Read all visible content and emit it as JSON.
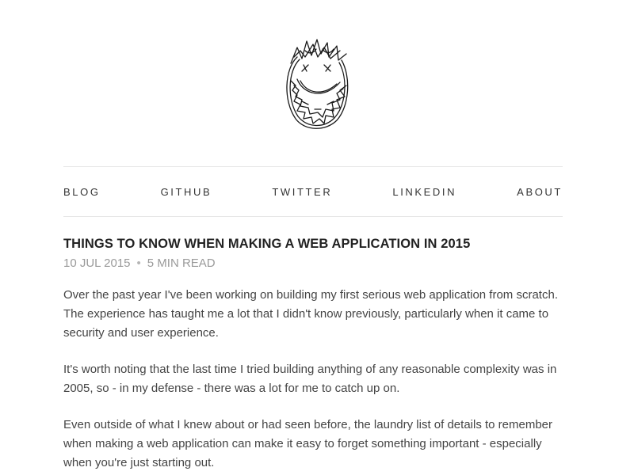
{
  "nav": {
    "items": [
      {
        "label": "BLOG"
      },
      {
        "label": "GITHUB"
      },
      {
        "label": "TWITTER"
      },
      {
        "label": "LINKEDIN"
      },
      {
        "label": "ABOUT"
      }
    ]
  },
  "logo": {
    "icon": "sketched-smiling-face-icon"
  },
  "post": {
    "title": "THINGS TO KNOW WHEN MAKING A WEB APPLICATION IN 2015",
    "date": "10 JUL 2015",
    "separator": "•",
    "read_time": "5 MIN READ",
    "paragraphs": [
      "Over the past year I've been working on building my first serious web application from scratch. The experience has taught me a lot that I didn't know previously, particularly when it came to security and user experience.",
      "It's worth noting that the last time I tried building anything of any reasonable complexity was in 2005, so - in my defense - there was a lot for me to catch up on.",
      "Even outside of what I knew about or had seen before, the laundry list of details to remember when making a web application can make it easy to forget something important - especially when you're just starting out."
    ]
  }
}
